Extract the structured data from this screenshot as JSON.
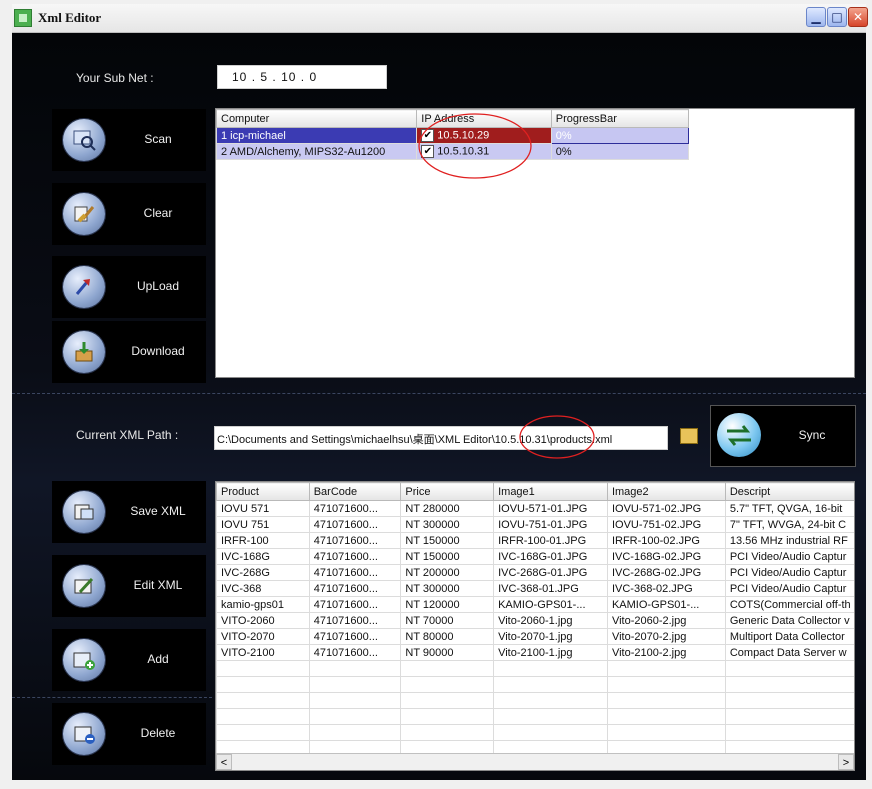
{
  "window": {
    "title": "Xml Editor"
  },
  "subnet": {
    "label": "Your Sub Net :",
    "octets": [
      "10",
      "5",
      "10",
      "0"
    ]
  },
  "buttons": {
    "scan": "Scan",
    "clear": "Clear",
    "upload": "UpLoad",
    "download": "Download",
    "save_xml": "Save XML",
    "edit_xml": "Edit XML",
    "add": "Add",
    "delete": "Delete",
    "sync": "Sync"
  },
  "computers": {
    "columns": [
      "Computer",
      "IP Address",
      "ProgressBar"
    ],
    "rows": [
      {
        "computer": "1 icp-michael",
        "ip": "10.5.10.29",
        "progress": "0%"
      },
      {
        "computer": "2 AMD/Alchemy, MIPS32-Au1200",
        "ip": "10.5.10.31",
        "progress": "0%"
      }
    ]
  },
  "xml_path": {
    "label": "Current XML Path :",
    "prefix": "C:\\Documents and Settings\\michaelhsu\\桌面\\XML Editor\\",
    "ip": "10.5.10.31",
    "suffix": "\\products.xml"
  },
  "products": {
    "columns": [
      "Product",
      "BarCode",
      "Price",
      "Image1",
      "Image2",
      "Descript"
    ],
    "rows": [
      [
        "IOVU 571",
        "471071600...",
        "NT 280000",
        "IOVU-571-01.JPG",
        "IOVU-571-02.JPG",
        "5.7\" TFT, QVGA, 16-bit"
      ],
      [
        "IOVU 751",
        "471071600...",
        "NT 300000",
        "IOVU-751-01.JPG",
        "IOVU-751-02.JPG",
        "7\" TFT, WVGA, 24-bit C"
      ],
      [
        "IRFR-100",
        "471071600...",
        "NT 150000",
        "IRFR-100-01.JPG",
        "IRFR-100-02.JPG",
        "13.56 MHz industrial RF"
      ],
      [
        "IVC-168G",
        "471071600...",
        "NT 150000",
        "IVC-168G-01.JPG",
        "IVC-168G-02.JPG",
        "PCI Video/Audio Captur"
      ],
      [
        "IVC-268G",
        "471071600...",
        "NT 200000",
        "IVC-268G-01.JPG",
        "IVC-268G-02.JPG",
        "PCI Video/Audio Captur"
      ],
      [
        "IVC-368",
        "471071600...",
        "NT 300000",
        "IVC-368-01.JPG",
        "IVC-368-02.JPG",
        "PCI Video/Audio Captur"
      ],
      [
        "kamio-gps01",
        "471071600...",
        "NT 120000",
        "KAMIO-GPS01-...",
        "KAMIO-GPS01-...",
        "COTS(Commercial off-th"
      ],
      [
        "VITO-2060",
        "471071600...",
        "NT 70000",
        "Vito-2060-1.jpg",
        "Vito-2060-2.jpg",
        "Generic Data Collector v"
      ],
      [
        "VITO-2070",
        "471071600...",
        "NT 80000",
        "Vito-2070-1.jpg",
        "Vito-2070-2.jpg",
        "Multiport Data Collector"
      ],
      [
        "VITO-2100",
        "471071600...",
        "NT 90000",
        "Vito-2100-1.jpg",
        "Vito-2100-2.jpg",
        "Compact Data Server w"
      ]
    ]
  },
  "scroll": {
    "left": "<",
    "right": ">"
  }
}
